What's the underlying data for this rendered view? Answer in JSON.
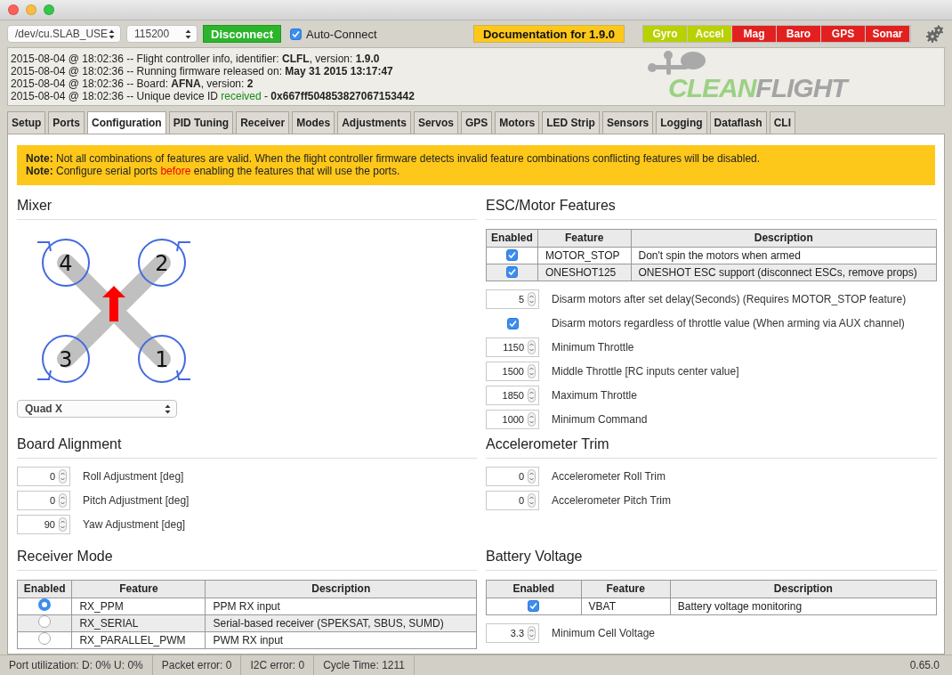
{
  "toolbar": {
    "port": "/dev/cu.SLAB_USE",
    "baud": "115200",
    "connect_button": "Disconnect",
    "auto_connect": {
      "label": "Auto-Connect",
      "checked": true
    },
    "documentation_button": "Documentation for 1.9.0",
    "sensors": [
      {
        "label": "Gyro",
        "on": true
      },
      {
        "label": "Accel",
        "on": true
      },
      {
        "label": "Mag",
        "on": false
      },
      {
        "label": "Baro",
        "on": false
      },
      {
        "label": "GPS",
        "on": false
      },
      {
        "label": "Sonar",
        "on": false
      }
    ]
  },
  "log": [
    [
      {
        "text": "2015-08-04 @ 18:02:36 -- Flight controller info, identifier: **CLFL**, version: **1.9.0**",
        "kind": "plain"
      }
    ],
    [
      {
        "text": "2015-08-04 @ 18:02:36 -- Running firmware released on: **May 31 2015 13:17:47**",
        "kind": "plain"
      }
    ],
    [
      {
        "text": "2015-08-04 @ 18:02:36 -- Board: **AFNA**, version: **2**",
        "kind": "plain"
      }
    ],
    [
      {
        "text": "2015-08-04 @ 18:02:36 -- Unique device ID ",
        "kind": "plain"
      },
      {
        "text": "received",
        "kind": "success"
      },
      {
        "text": " - **0x667ff504853827067153442**",
        "kind": "plain"
      }
    ]
  ],
  "logo": {
    "first": "CLEAN",
    "second": "FLIGHT"
  },
  "tabs": [
    {
      "label": "Setup",
      "selected": false
    },
    {
      "label": "Ports",
      "selected": false
    },
    {
      "label": "Configuration",
      "selected": true
    },
    {
      "label": "PID Tuning",
      "selected": false
    },
    {
      "label": "Receiver",
      "selected": false
    },
    {
      "label": "Modes",
      "selected": false
    },
    {
      "label": "Adjustments",
      "selected": false
    },
    {
      "label": "Servos",
      "selected": false
    },
    {
      "label": "GPS",
      "selected": false
    },
    {
      "label": "Motors",
      "selected": false
    },
    {
      "label": "LED Strip",
      "selected": false
    },
    {
      "label": "Sensors",
      "selected": false
    },
    {
      "label": "Logging",
      "selected": false
    },
    {
      "label": "Dataflash",
      "selected": false
    },
    {
      "label": "CLI",
      "selected": false
    }
  ],
  "notes": [
    [
      {
        "text": "**Note:** Not all combinations of features are valid. When the flight controller firmware detects invalid feature combinations conflicting features will be disabled.",
        "kind": "plain"
      }
    ],
    [
      {
        "text": "**Note:** Configure serial ports ",
        "kind": "plain"
      },
      {
        "text": "before",
        "kind": "warning"
      },
      {
        "text": " enabling the features that will use the ports.",
        "kind": "plain"
      }
    ]
  ],
  "mixer": {
    "title": "Mixer",
    "motors": [
      "4",
      "2",
      "3",
      "1"
    ],
    "type": "Quad X"
  },
  "esc": {
    "title": "ESC/Motor Features",
    "columns": [
      "Enabled",
      "Feature",
      "Description"
    ],
    "rows": [
      {
        "enabled": true,
        "feature": "MOTOR_STOP",
        "description": "Don't spin the motors when armed"
      },
      {
        "enabled": true,
        "feature": "ONESHOT125",
        "description": "ONESHOT ESC support (disconnect ESCs, remove props)"
      }
    ],
    "settings": [
      {
        "kind": "number",
        "value": "5",
        "label": "Disarm motors after set delay(Seconds) (Requires MOTOR_STOP feature)"
      },
      {
        "kind": "checkbox",
        "checked": true,
        "label": "Disarm motors regardless of throttle value (When arming via AUX channel)"
      },
      {
        "kind": "number",
        "value": "1150",
        "label": "Minimum Throttle"
      },
      {
        "kind": "number",
        "value": "1500",
        "label": "Middle Throttle [RC inputs center value]"
      },
      {
        "kind": "number",
        "value": "1850",
        "label": "Maximum Throttle"
      },
      {
        "kind": "number",
        "value": "1000",
        "label": "Minimum Command"
      }
    ]
  },
  "board_alignment": {
    "title": "Board Alignment",
    "settings": [
      {
        "kind": "number",
        "value": "0",
        "label": "Roll Adjustment [deg]"
      },
      {
        "kind": "number",
        "value": "0",
        "label": "Pitch Adjustment [deg]"
      },
      {
        "kind": "number",
        "value": "90",
        "label": "Yaw Adjustment [deg]"
      }
    ]
  },
  "accelerometer_trim": {
    "title": "Accelerometer Trim",
    "settings": [
      {
        "kind": "number",
        "value": "0",
        "label": "Accelerometer Roll Trim"
      },
      {
        "kind": "number",
        "value": "0",
        "label": "Accelerometer Pitch Trim"
      }
    ]
  },
  "receiver_mode": {
    "title": "Receiver Mode",
    "columns": [
      "Enabled",
      "Feature",
      "Description"
    ],
    "rows": [
      {
        "selected": true,
        "feature": "RX_PPM",
        "description": "PPM RX input"
      },
      {
        "selected": false,
        "feature": "RX_SERIAL",
        "description": "Serial-based receiver (SPEKSAT, SBUS, SUMD)"
      },
      {
        "selected": false,
        "feature": "RX_PARALLEL_PWM",
        "description": "PWM RX input"
      }
    ]
  },
  "battery_voltage": {
    "title": "Battery Voltage",
    "columns": [
      "Enabled",
      "Feature",
      "Description"
    ],
    "rows": [
      {
        "enabled": true,
        "feature": "VBAT",
        "description": "Battery voltage monitoring"
      }
    ],
    "settings": [
      {
        "kind": "number",
        "value": "3.3",
        "label": "Minimum Cell Voltage"
      }
    ]
  },
  "status_bar": {
    "items": [
      "Port utilization: D: 0% U: 0%",
      "Packet error: 0",
      "I2C error: 0",
      "Cycle Time: 1211"
    ],
    "version": "0.65.0"
  }
}
